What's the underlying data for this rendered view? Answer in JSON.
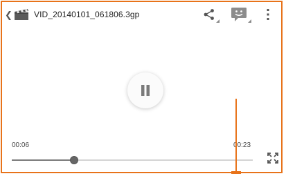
{
  "header": {
    "back_icon": "chevron-left-icon",
    "file_icon": "clapperboard-icon",
    "title": "VID_20140101_061806.3gp",
    "actions": [
      {
        "icon": "share-icon"
      },
      {
        "icon": "message-face-icon"
      },
      {
        "icon": "more-vertical-icon"
      }
    ]
  },
  "player": {
    "state": "playing",
    "center_button_icon": "pause-icon",
    "current_time": "00:06",
    "duration": "00:23",
    "progress_fraction": 0.26,
    "fullscreen_icon": "fullscreen-expand-icon"
  },
  "colors": {
    "accent": "#e8731a",
    "message_badge": "#8c8c8c"
  }
}
